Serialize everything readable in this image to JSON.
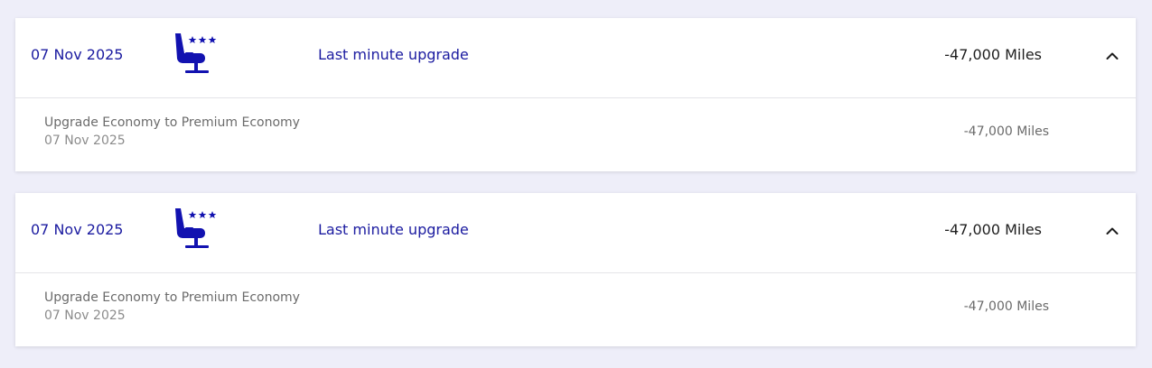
{
  "colors": {
    "accent": "#1b1ba0",
    "background": "#eeeef9",
    "icon": "#1212b0"
  },
  "transactions": [
    {
      "date": "07 Nov 2025",
      "icon": "premium-seat-icon",
      "description": "Last minute upgrade",
      "miles": "-47,000 Miles",
      "expanded": true,
      "detail": {
        "title": "Upgrade Economy to Premium Economy",
        "date": "07 Nov 2025",
        "miles": "-47,000 Miles"
      }
    },
    {
      "date": "07 Nov 2025",
      "icon": "premium-seat-icon",
      "description": "Last minute upgrade",
      "miles": "-47,000 Miles",
      "expanded": true,
      "detail": {
        "title": "Upgrade Economy to Premium Economy",
        "date": "07 Nov 2025",
        "miles": "-47,000 Miles"
      }
    }
  ]
}
